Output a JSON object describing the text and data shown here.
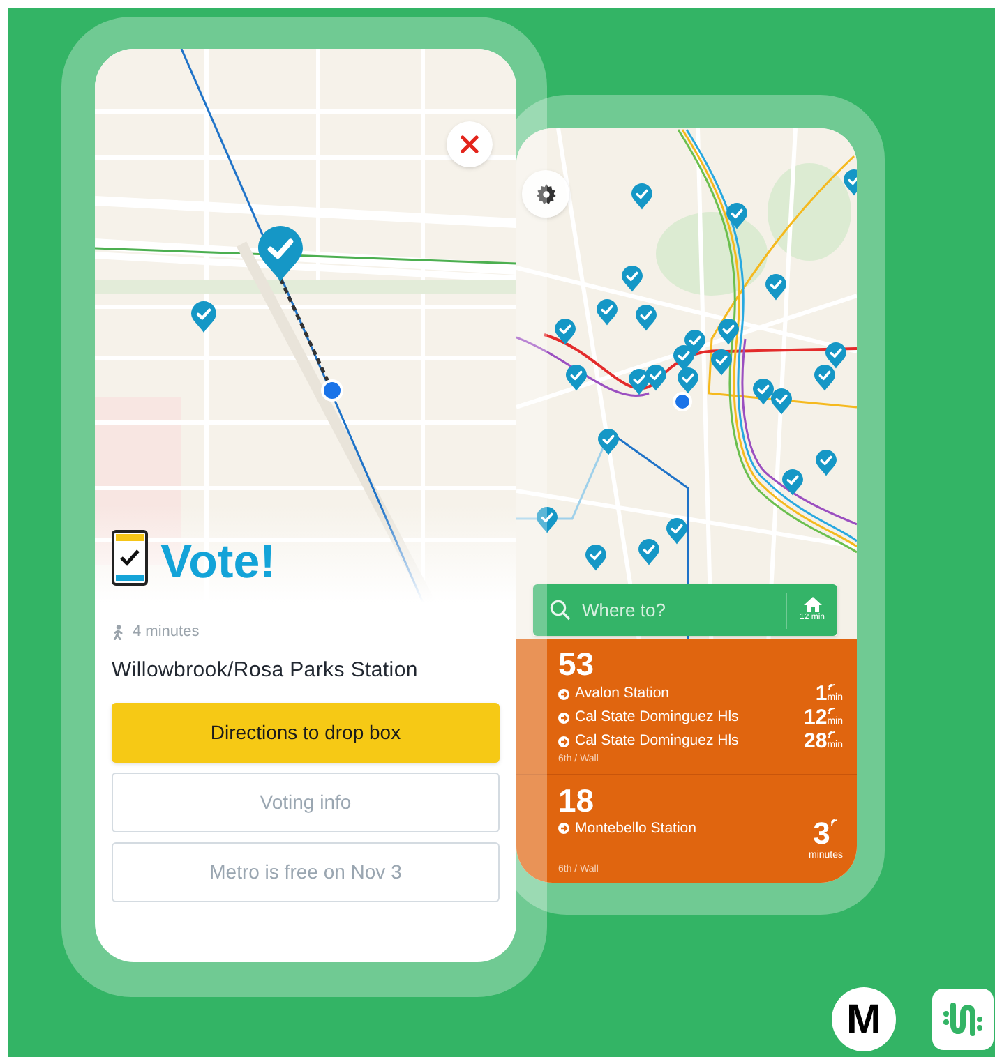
{
  "front_screen": {
    "vote_banner": {
      "label": "Vote!"
    },
    "walk_time": "4 minutes",
    "station": "Willowbrook/Rosa Parks Station",
    "buttons": [
      {
        "label": "Directions to drop box",
        "kind": "primary"
      },
      {
        "label": "Voting info",
        "kind": "outline"
      },
      {
        "label": "Metro is free on Nov 3",
        "kind": "outline"
      }
    ]
  },
  "back_screen": {
    "search": {
      "placeholder": "Where to?"
    },
    "home_shortcut": {
      "time": "12 min"
    },
    "routes": [
      {
        "number": "53",
        "stop": "6th / Wall",
        "departures": [
          {
            "destination": "Avalon Station",
            "time": "1",
            "unit": "min",
            "kind": "inline"
          },
          {
            "destination": "Cal State Dominguez Hls",
            "time": "12",
            "unit": "min",
            "kind": "inline"
          },
          {
            "destination": "Cal State Dominguez Hls",
            "time": "28",
            "unit": "min",
            "kind": "inline"
          }
        ]
      },
      {
        "number": "18",
        "stop": "6th / Wall",
        "departures": [
          {
            "destination": "Montebello Station",
            "time": "3",
            "unit": "minutes",
            "kind": "stacked"
          }
        ]
      }
    ]
  },
  "logos": [
    {
      "kind": "metro",
      "text": "M"
    },
    {
      "kind": "transit"
    }
  ]
}
